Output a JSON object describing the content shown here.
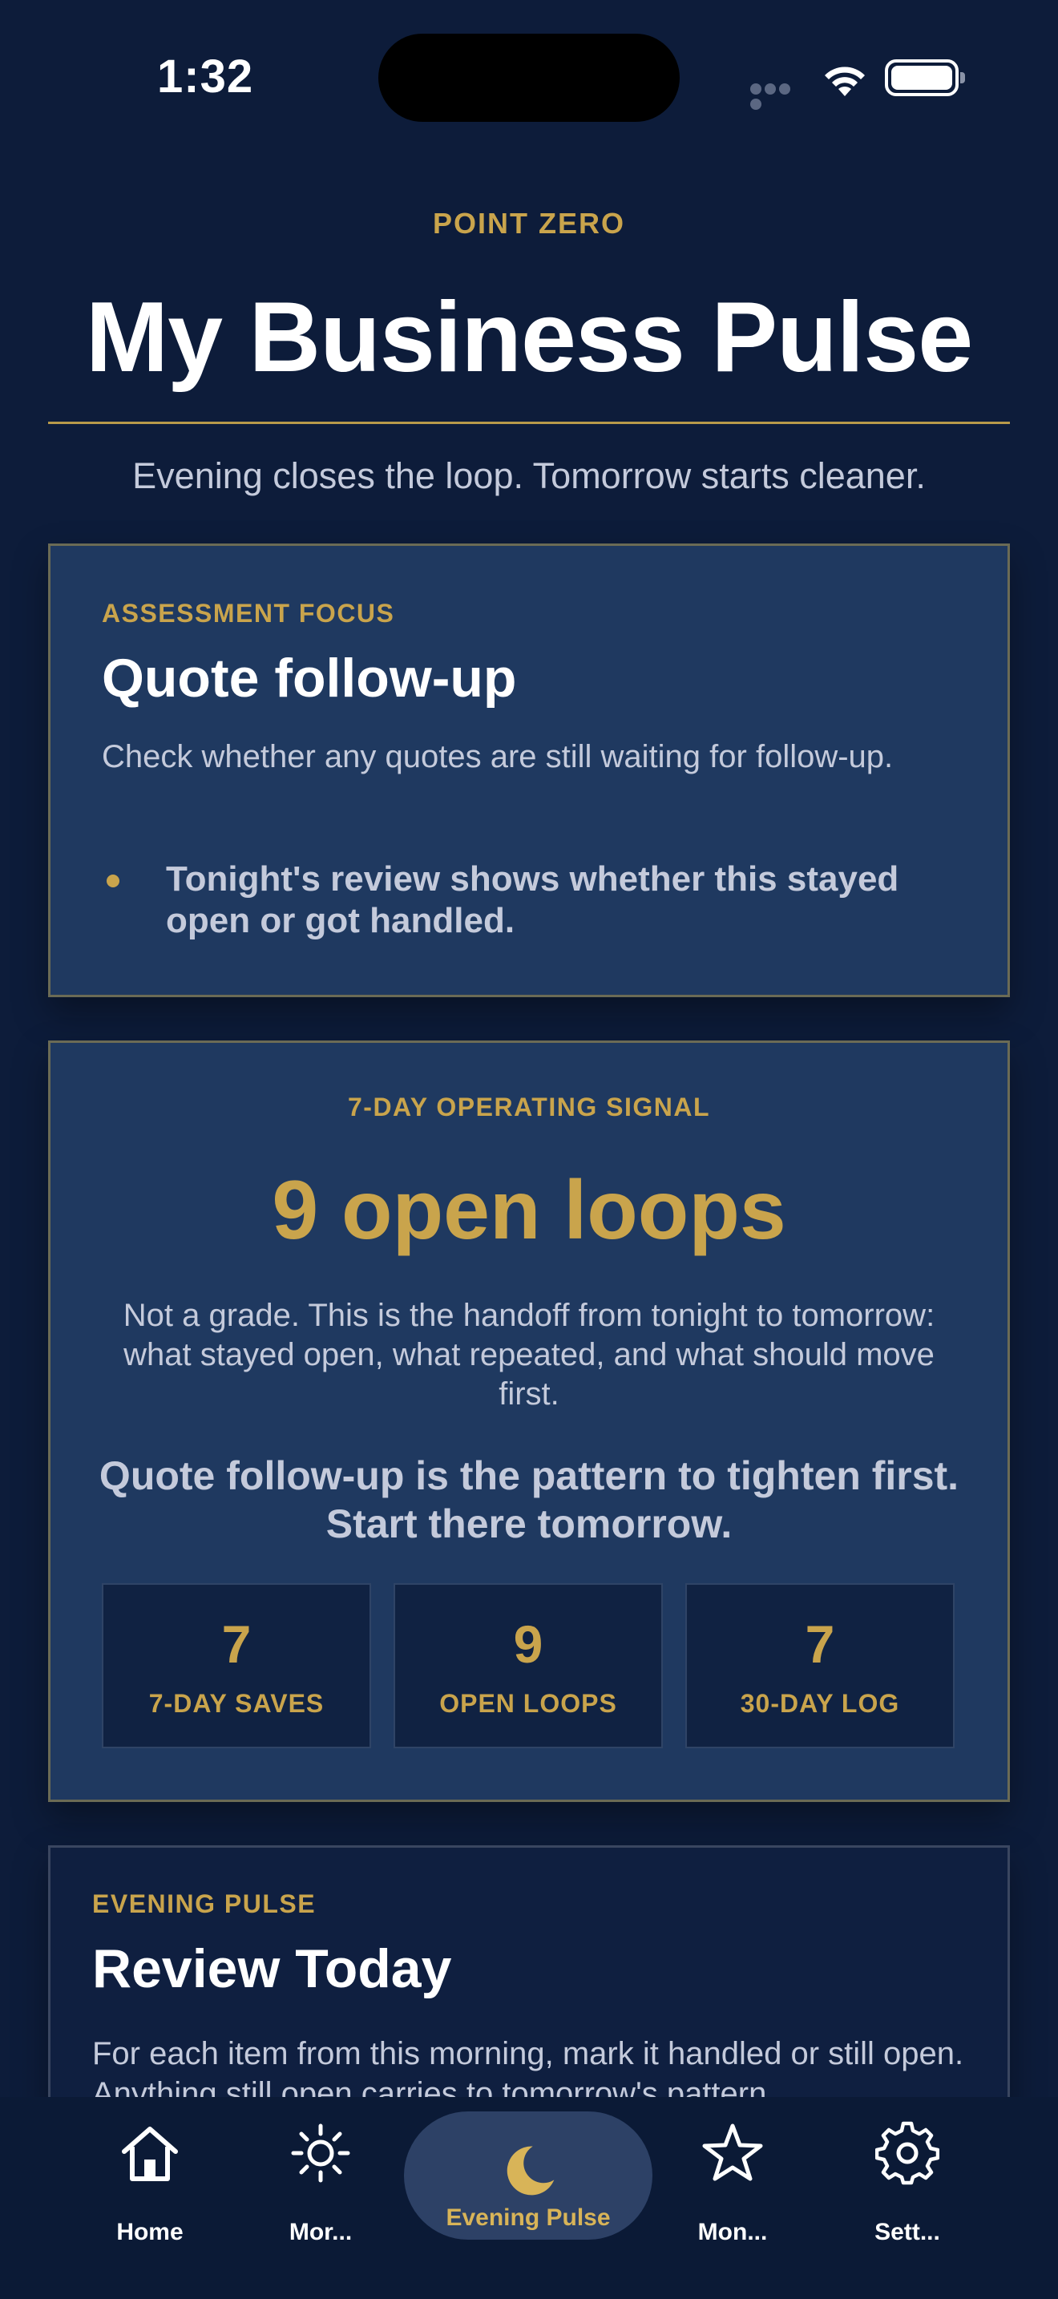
{
  "status_bar": {
    "time": "1:32"
  },
  "header": {
    "eyebrow": "POINT ZERO",
    "title": "My Business Pulse",
    "subtitle": "Evening closes the loop. Tomorrow starts cleaner."
  },
  "focus_card": {
    "label": "ASSESSMENT FOCUS",
    "title": "Quote follow-up",
    "description": "Check whether any quotes are still waiting for follow-up.",
    "bullet": "Tonight's review shows whether this stayed open or got handled."
  },
  "signal_card": {
    "label": "7-DAY OPERATING SIGNAL",
    "value": "9 open loops",
    "description": "Not a grade. This is the handoff from tonight to tomorrow: what stayed open, what repeated, and what should move first.",
    "callout": "Quote follow-up is the pattern to tighten first. Start there tomorrow.",
    "stats": [
      {
        "value": "7",
        "label": "7-DAY SAVES"
      },
      {
        "value": "9",
        "label": "OPEN LOOPS"
      },
      {
        "value": "7",
        "label": "30-DAY LOG"
      }
    ]
  },
  "evening_card": {
    "label": "EVENING PULSE",
    "title": "Review Today",
    "description": "For each item from this morning, mark it handled or still open. Anything still open carries to tomorrow's pattern."
  },
  "tab_bar": {
    "items": [
      {
        "label": "Home",
        "icon": "home-icon",
        "active": false
      },
      {
        "label": "Mor...",
        "icon": "sun-icon",
        "active": false
      },
      {
        "label": "Evening Pulse",
        "icon": "moon-icon",
        "active": true
      },
      {
        "label": "Mon...",
        "icon": "star-icon",
        "active": false
      },
      {
        "label": "Sett...",
        "icon": "gear-icon",
        "active": false
      }
    ]
  },
  "colors": {
    "background": "#0d1c3a",
    "card": "#1f3960",
    "accent_gold": "#c9a44c",
    "text_muted": "#c4cadb"
  }
}
